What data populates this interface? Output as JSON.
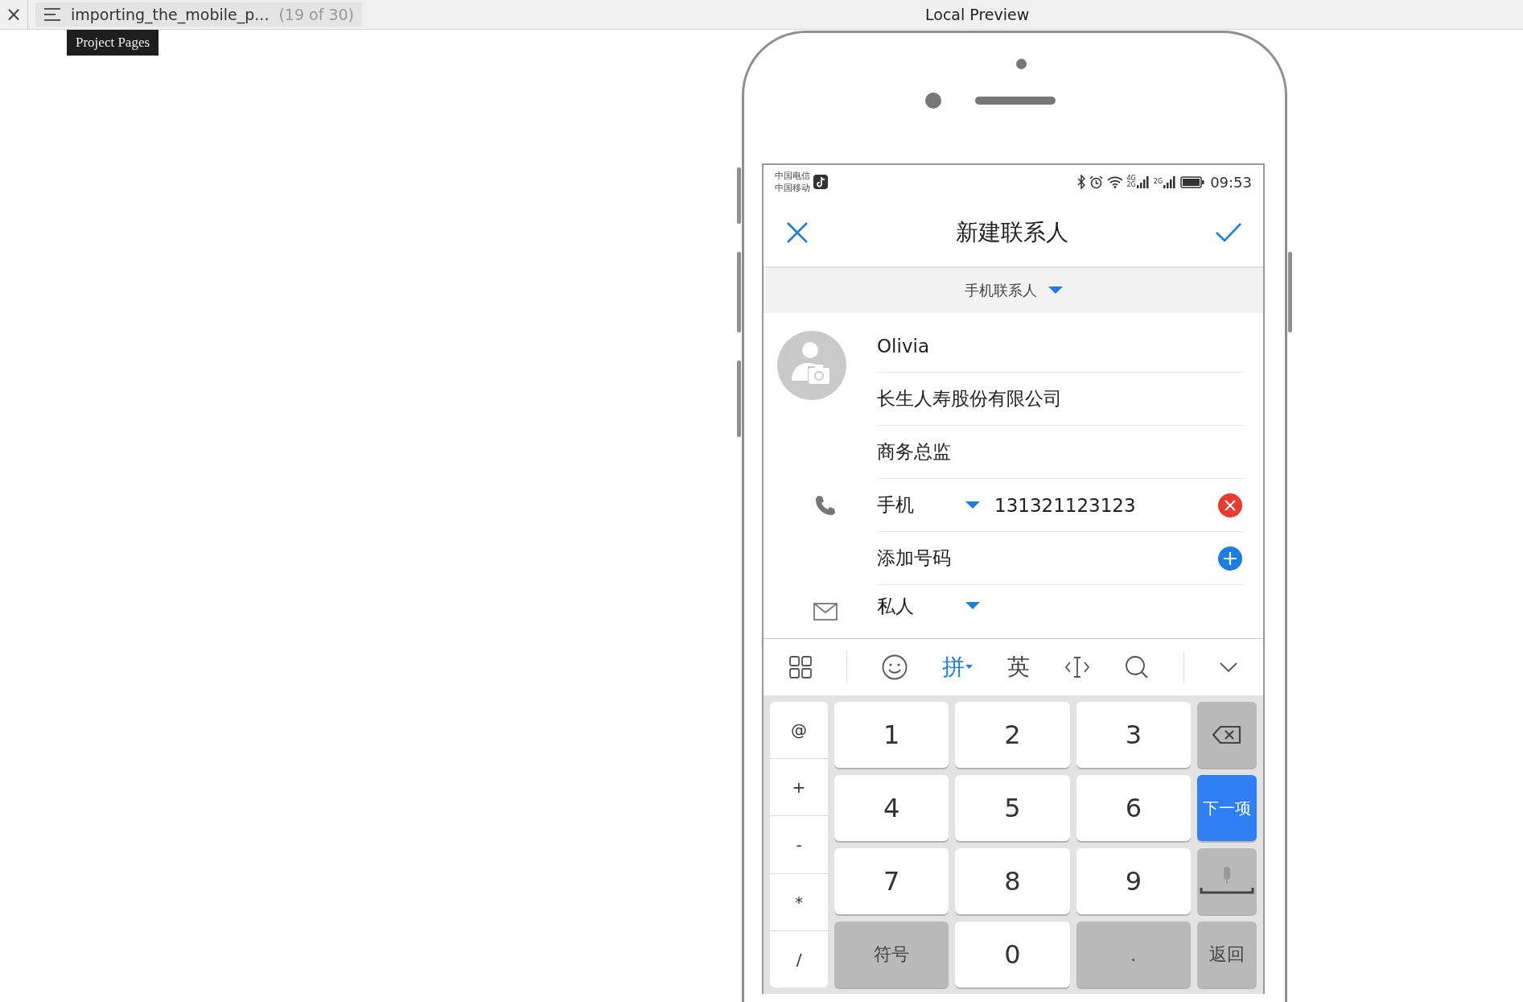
{
  "app_bar": {
    "close": "×",
    "page_tab": {
      "title": "importing_the_mobile_p...",
      "count": "(19 of 30)"
    },
    "title": "Local Preview",
    "tooltip": "Project Pages"
  },
  "phone": {
    "status_bar": {
      "carriers": [
        "中国电信",
        "中国移动"
      ],
      "signals": [
        {
          "labels": [
            "4G",
            "2G"
          ]
        },
        {
          "labels": [
            "2G"
          ]
        }
      ],
      "time": "09:53"
    },
    "header": {
      "title": "新建联系人"
    },
    "account": {
      "label": "手机联系人"
    },
    "fields": [
      {
        "kind": "name",
        "value": "Olivia"
      },
      {
        "kind": "text",
        "value": "长生人寿股份有限公司"
      },
      {
        "kind": "text",
        "value": "商务总监"
      },
      {
        "kind": "phone",
        "type_label": "手机",
        "value": "131321123123"
      },
      {
        "kind": "add",
        "label": "添加号码"
      },
      {
        "kind": "email",
        "type_label": "私人"
      }
    ],
    "keyboard": {
      "toolbar": [
        {
          "kind": "grid"
        },
        {
          "kind": "emoji"
        },
        {
          "kind": "text",
          "label": "拼",
          "selected": true
        },
        {
          "kind": "text",
          "label": "英",
          "selected": false
        },
        {
          "kind": "cursor"
        },
        {
          "kind": "search"
        },
        {
          "kind": "hide"
        }
      ],
      "side_keys": [
        "@",
        "+",
        "-",
        "*",
        "/"
      ],
      "keys": [
        {
          "kind": "digit",
          "label": "1"
        },
        {
          "kind": "digit",
          "label": "2"
        },
        {
          "kind": "digit",
          "label": "3"
        },
        {
          "kind": "backspace"
        },
        {
          "kind": "digit",
          "label": "4"
        },
        {
          "kind": "digit",
          "label": "5"
        },
        {
          "kind": "digit",
          "label": "6"
        },
        {
          "kind": "action",
          "label": "下一项"
        },
        {
          "kind": "digit",
          "label": "7"
        },
        {
          "kind": "digit",
          "label": "8"
        },
        {
          "kind": "digit",
          "label": "9"
        },
        {
          "kind": "space"
        },
        {
          "kind": "function",
          "label": "符号"
        },
        {
          "kind": "digit",
          "label": "0"
        },
        {
          "kind": "function",
          "label": "."
        },
        {
          "kind": "function",
          "label": "返回"
        }
      ]
    }
  }
}
